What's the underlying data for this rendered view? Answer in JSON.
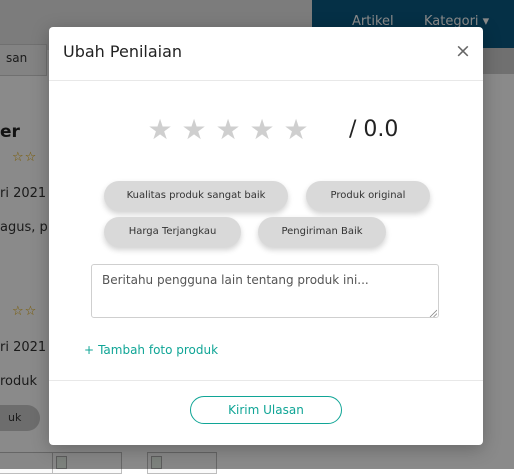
{
  "background": {
    "nav_links": [
      "Artikel",
      "Kategori ▾"
    ],
    "tab_label": "san",
    "reviewer_name": "er",
    "date_1": "ri 2021",
    "review_text": "agus, p",
    "date_2": "ri 2021",
    "product_text": "roduk",
    "chip_label": "uk"
  },
  "modal": {
    "title": "Ubah Penilaian",
    "close_symbol": "×"
  },
  "rating": {
    "stars": [
      "★",
      "★",
      "★",
      "★",
      "★"
    ],
    "selected": 0,
    "score_text": "/ 0.0",
    "empty_star_color": "#cfcfcf"
  },
  "tags": [
    "Kualitas produk sangat baik",
    "Produk original",
    "Harga Terjangkau",
    "Pengiriman Baik"
  ],
  "review": {
    "placeholder": "Beritahu pengguna lain tentang produk ini...",
    "value": ""
  },
  "add_photo": {
    "icon": "+",
    "label": "Tambah foto produk"
  },
  "footer": {
    "submit_label": "Kirim Ulasan"
  },
  "colors": {
    "accent": "#10a596",
    "nav": "#0a5a82",
    "background_star": "#e2a800"
  }
}
